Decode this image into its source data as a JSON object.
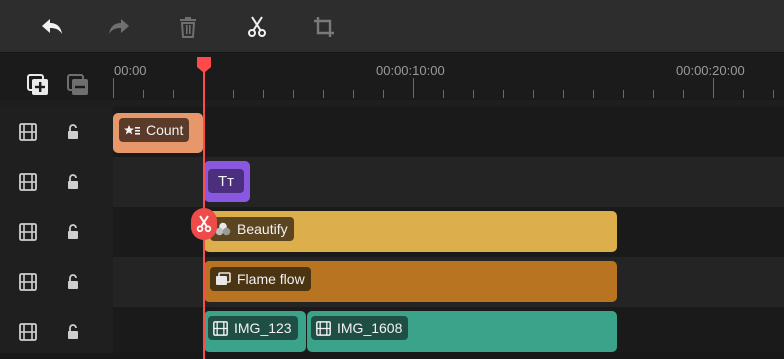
{
  "toolbar": {
    "tools": [
      {
        "name": "undo",
        "icon": "undo-arrow-icon",
        "enabled": true
      },
      {
        "name": "redo",
        "icon": "redo-arrow-icon",
        "enabled": false
      },
      {
        "name": "delete",
        "icon": "trash-icon",
        "enabled": false
      },
      {
        "name": "split",
        "icon": "scissors-icon",
        "enabled": true
      },
      {
        "name": "crop",
        "icon": "crop-icon",
        "enabled": false
      }
    ]
  },
  "timeline_header": {
    "add_track_icon": "add-track-icon",
    "remove_track_icon": "remove-track-icon"
  },
  "ruler": {
    "labels": [
      "00:00",
      "00:00:10:00",
      "00:00:20:00"
    ]
  },
  "tracks": [
    {
      "type_icon": "film-icon",
      "lock_icon": "unlock-icon"
    },
    {
      "type_icon": "film-icon",
      "lock_icon": "unlock-icon"
    },
    {
      "type_icon": "film-icon",
      "lock_icon": "unlock-icon"
    },
    {
      "type_icon": "film-icon",
      "lock_icon": "unlock-icon"
    },
    {
      "type_icon": "film-icon",
      "lock_icon": "unlock-icon"
    }
  ],
  "clips": {
    "countdown": {
      "label": "Count",
      "icon": "sticker-icon",
      "color": "#e8976a"
    },
    "text": {
      "label": "Tт",
      "icon": "text-icon",
      "color": "#8a58e0"
    },
    "beautify": {
      "label": "Beautify",
      "icon": "beautify-icon",
      "color": "#dcae4c"
    },
    "flame_flow": {
      "label": "Flame flow",
      "icon": "transition-icon",
      "color": "#b87420"
    },
    "img_123": {
      "label": "IMG_123",
      "icon": "film-icon",
      "color": "#3aa38a"
    },
    "img_1608": {
      "label": "IMG_1608",
      "icon": "film-icon",
      "color": "#3aa38a"
    }
  },
  "playhead": {
    "color": "#ff4a4a"
  }
}
